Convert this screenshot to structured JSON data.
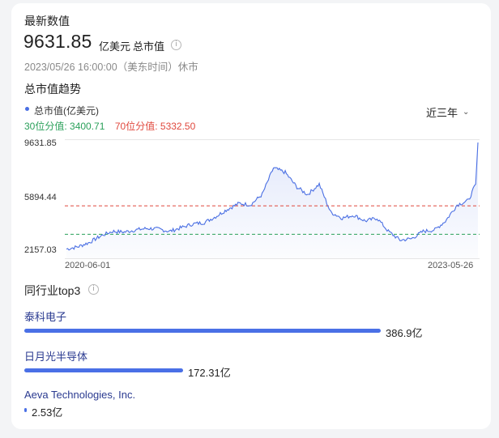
{
  "header": {
    "title": "最新数值",
    "value": "9631.85",
    "unit": "亿美元",
    "metric": "总市值",
    "info_icon": "info-icon",
    "timestamp": "2023/05/26 16:00:00（美东时间）休市"
  },
  "trend": {
    "title": "总市值趋势",
    "legend": "总市值(亿美元)",
    "q30_label": "30位分值: ",
    "q30_value": "3400.71",
    "q70_label": "70位分值: ",
    "q70_value": "5332.50",
    "range_label": "近三年",
    "range_icon": "chevron-down-icon"
  },
  "chart_data": {
    "type": "area",
    "x_start": "2020-06-01",
    "x_end": "2023-05-26",
    "ylim": [
      2157.03,
      9631.85
    ],
    "yticks": [
      "9631.85",
      "5894.44",
      "2157.03"
    ],
    "xticks": [
      "2020-06-01",
      "2023-05-26"
    ],
    "reference_lines": [
      {
        "label": "30位分值",
        "value": 3400.71,
        "color": "#2aa05a"
      },
      {
        "label": "70位分值",
        "value": 5332.5,
        "color": "#e0483d"
      }
    ],
    "line_color": "#4a6fe3",
    "series": [
      {
        "name": "总市值(亿美元)",
        "x": [
          "2020-06-01",
          "2020-07-01",
          "2020-08-01",
          "2020-09-01",
          "2020-10-01",
          "2020-11-01",
          "2020-12-01",
          "2021-01-01",
          "2021-02-01",
          "2021-03-01",
          "2021-04-01",
          "2021-05-01",
          "2021-06-01",
          "2021-07-01",
          "2021-08-01",
          "2021-09-01",
          "2021-10-01",
          "2021-11-01",
          "2021-12-01",
          "2022-01-01",
          "2022-02-01",
          "2022-03-01",
          "2022-04-01",
          "2022-05-01",
          "2022-06-01",
          "2022-07-01",
          "2022-08-01",
          "2022-09-01",
          "2022-10-01",
          "2022-11-01",
          "2022-12-01",
          "2023-01-01",
          "2023-02-01",
          "2023-03-01",
          "2023-04-01",
          "2023-05-01",
          "2023-05-20",
          "2023-05-26"
        ],
        "values": [
          2400,
          2550,
          2850,
          3300,
          3600,
          3550,
          3700,
          3800,
          3750,
          3600,
          3850,
          4100,
          4200,
          4600,
          5100,
          5500,
          5400,
          6100,
          7900,
          7600,
          6600,
          6100,
          6800,
          4900,
          4500,
          4700,
          4300,
          4500,
          3600,
          3000,
          3100,
          3600,
          3700,
          4300,
          5400,
          5700,
          6800,
          9631.85
        ]
      }
    ]
  },
  "peers": {
    "title": "同行业top3",
    "info_icon": "info-icon",
    "max_value": 386.9,
    "items": [
      {
        "name": "泰科电子",
        "value": 386.9,
        "value_label": "386.9亿"
      },
      {
        "name": "日月光半导体",
        "value": 172.31,
        "value_label": "172.31亿"
      },
      {
        "name": "Aeva Technologies, Inc.",
        "value": 2.53,
        "value_label": "2.53亿"
      }
    ]
  }
}
